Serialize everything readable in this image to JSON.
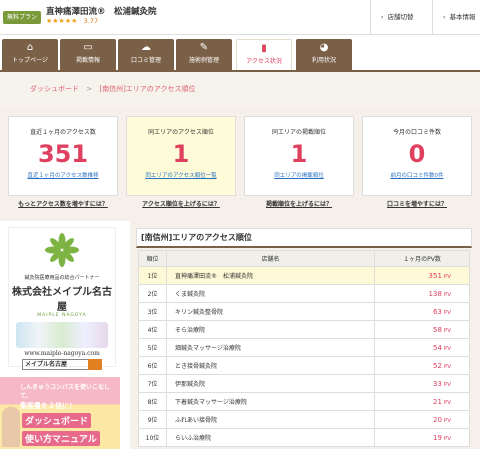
{
  "header": {
    "plan_badge": "無料プラン",
    "company": "鍼灸院なら鍼灸院名",
    "shop_name": "直神痛澤田流®　松浦鍼灸院",
    "stars": "★★★★★",
    "score": "3.77",
    "links": [
      {
        "icon": "arrow-icon",
        "label": "店舗切替"
      },
      {
        "icon": "arrow-icon",
        "label": "基本情報"
      }
    ]
  },
  "nav": {
    "tabs": [
      {
        "label": "トップページ",
        "icon": "home-icon",
        "glyph": "⌂",
        "active": false
      },
      {
        "label": "掲載情報",
        "icon": "monitor-icon",
        "glyph": "▭",
        "active": false
      },
      {
        "label": "口コミ管理",
        "icon": "chat-icon",
        "glyph": "☁",
        "active": false
      },
      {
        "label": "施術例管理",
        "icon": "edit-icon",
        "glyph": "✎",
        "active": false
      },
      {
        "label": "アクセス状況",
        "icon": "bar-chart-icon",
        "glyph": "▮",
        "active": true
      },
      {
        "label": "利用状況",
        "icon": "pie-chart-icon",
        "glyph": "◕",
        "active": false
      }
    ]
  },
  "breadcrumb": {
    "home": "ダッシュボード",
    "separator": ">",
    "current": "[南信州]エリアのアクセス順位"
  },
  "stats": [
    {
      "title": "直近１ヶ月のアクセス数",
      "value": "351",
      "link": "直近１ヶ月のアクセス数推移",
      "more": "もっとアクセス数を増やすには？",
      "highlight": false
    },
    {
      "title": "同エリアのアクセス順位",
      "value": "1",
      "link": "同エリアのアクセス順位一覧",
      "more": "アクセス順位を上げるには？",
      "highlight": true
    },
    {
      "title": "同エリアの掲載順位",
      "value": "1",
      "link": "同エリアの掲載順位",
      "more": "掲載順位を上げるには？",
      "highlight": false
    },
    {
      "title": "今月の口コミ件数",
      "value": "0",
      "link": "前月の口コミ件数0件",
      "more": "口コミを増やすには？",
      "highlight": false
    }
  ],
  "ads": {
    "ad1": {
      "tagline": "鍼灸院医療用品の総合パートナー",
      "company": "株式会社メイプル名古屋",
      "company_en": "MAIPLE NAGOYA",
      "url": "www.maiple-nagoya.com",
      "search": "メイプル名古屋"
    },
    "ad2": {
      "line1": "しんきゅうコンパスを使いこなして、",
      "line2": "集客量を３倍に！",
      "line3": "ダッシュボード",
      "line4": "使い方マニュアル"
    }
  },
  "ranking": {
    "title": "[南信州]エリアのアクセス順位",
    "columns": [
      "順位",
      "店舗名",
      "１ヶ月のPV数"
    ],
    "unit": "PV",
    "rows": [
      {
        "rank": "1位",
        "name": "直神痛澤田流®　松浦鍼灸院",
        "pv": "351",
        "me": true
      },
      {
        "rank": "2位",
        "name": "くま鍼灸院",
        "pv": "138",
        "me": false
      },
      {
        "rank": "3位",
        "name": "キリン鍼灸整骨院",
        "pv": "63",
        "me": false
      },
      {
        "rank": "4位",
        "name": "そら治療院",
        "pv": "58",
        "me": false
      },
      {
        "rank": "5位",
        "name": "畑鍼灸マッサージ治療院",
        "pv": "54",
        "me": false
      },
      {
        "rank": "6位",
        "name": "とき接骨鍼灸院",
        "pv": "52",
        "me": false
      },
      {
        "rank": "7位",
        "name": "伊那鍼灸院",
        "pv": "33",
        "me": false
      },
      {
        "rank": "8位",
        "name": "下着鍼灸マッサージ治療院",
        "pv": "21",
        "me": false
      },
      {
        "rank": "9位",
        "name": "ふれあい接骨院",
        "pv": "20",
        "me": false
      },
      {
        "rank": "10位",
        "name": "らいふ治療院",
        "pv": "19",
        "me": false
      }
    ]
  },
  "colors": {
    "nav_brown": "#7b6048",
    "accent_pink": "#e04060",
    "link_blue": "#2a70c0",
    "highlight_yellow": "#fdfbd8"
  }
}
